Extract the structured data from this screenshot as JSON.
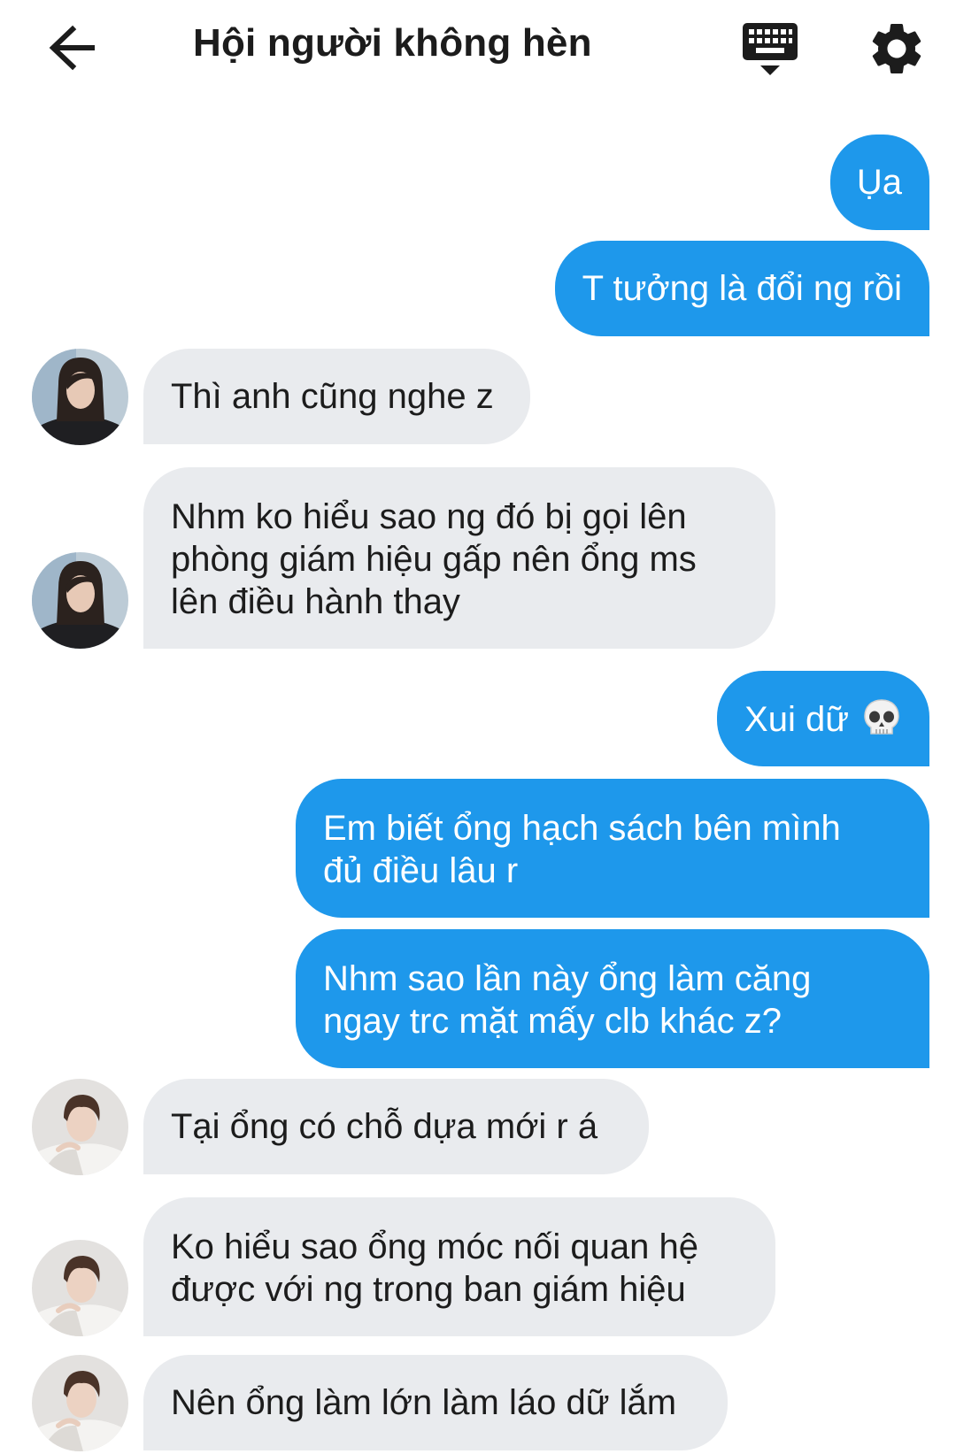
{
  "header": {
    "title": "Hội người không hèn",
    "back_icon": "arrow-left-icon",
    "keyboard_icon": "keyboard-icon",
    "settings_icon": "gear-icon"
  },
  "colors": {
    "outgoing_bubble": "#1e98eb",
    "incoming_bubble": "#e9ebee"
  },
  "messages": [
    {
      "side": "out",
      "text": "Ụa"
    },
    {
      "side": "out",
      "text": "T tưởng là đổi ng rồi"
    },
    {
      "side": "in",
      "sender": "avatar-1",
      "text": "Thì anh cũng nghe z"
    },
    {
      "side": "in",
      "sender": "avatar-1",
      "lines": [
        "Nhm ko hiểu sao ng đó bị gọi lên",
        "phòng giám hiệu gấp nên ổng ms",
        "lên điều hành thay"
      ]
    },
    {
      "side": "out",
      "text": "Xui dữ",
      "emoji": "skull-icon"
    },
    {
      "side": "out",
      "lines": [
        "Em biết ổng hạch sách bên mình",
        "đủ điều lâu r"
      ]
    },
    {
      "side": "out",
      "lines": [
        "Nhm sao lần này ổng làm căng",
        "ngay trc mặt mấy clb khác z?"
      ]
    },
    {
      "side": "in",
      "sender": "avatar-2",
      "text": "Tại ổng có chỗ dựa mới r á"
    },
    {
      "side": "in",
      "sender": "avatar-2",
      "lines": [
        "Ko hiểu sao ổng móc nối quan hệ",
        "được với ng trong ban giám hiệu"
      ]
    },
    {
      "side": "in",
      "sender": "avatar-2",
      "text": "Nên ổng làm lớn làm láo dữ lắm"
    }
  ]
}
